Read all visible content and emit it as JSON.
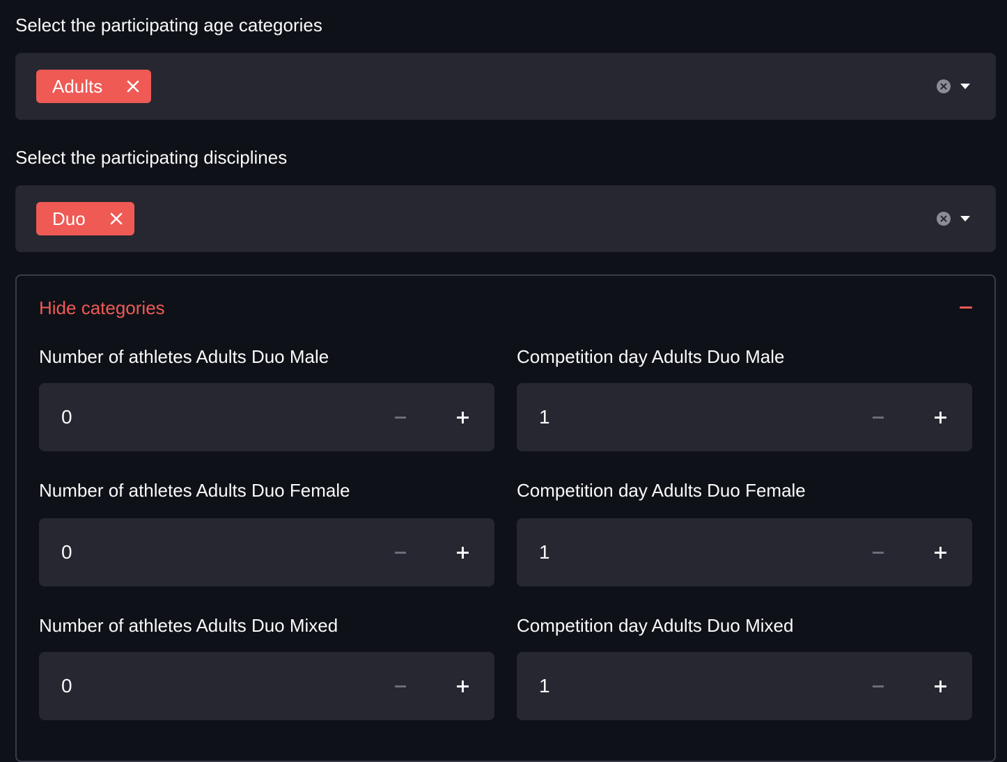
{
  "age_select": {
    "label": "Select the participating age categories",
    "tags": [
      "Adults"
    ]
  },
  "discipline_select": {
    "label": "Select the participating disciplines",
    "tags": [
      "Duo"
    ]
  },
  "expander": {
    "title": "Hide categories",
    "fields": [
      {
        "label": "Number of athletes Adults Duo Male",
        "value": "0"
      },
      {
        "label": "Competition day Adults Duo Male",
        "value": "1"
      },
      {
        "label": "Number of athletes Adults Duo Female",
        "value": "0"
      },
      {
        "label": "Competition day Adults Duo Female",
        "value": "1"
      },
      {
        "label": "Number of athletes Adults Duo Mixed",
        "value": "0"
      },
      {
        "label": "Competition day Adults Duo Mixed",
        "value": "1"
      }
    ]
  },
  "colors": {
    "background": "#0e1117",
    "input_background": "#262730",
    "accent": "#ef5a55",
    "text": "#fafafa"
  },
  "icons": {
    "tag_remove": "close-icon",
    "clear_all": "clear-circle-icon",
    "dropdown": "chevron-down-icon",
    "collapse": "minus-icon",
    "decrement": "minus-icon",
    "increment": "plus-icon"
  }
}
